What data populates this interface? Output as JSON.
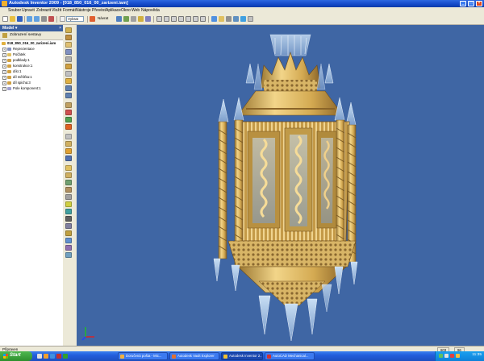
{
  "window": {
    "title": "Autodesk Inventor 2009 - [018_850_016_00_zarizeni.iam]",
    "buttons": {
      "minimize": "_",
      "maximize": "□",
      "close": "×"
    }
  },
  "menu": {
    "items": [
      "Soubor",
      "Upravit",
      "Zobrazit",
      "Vložit",
      "Formát",
      "Nástroje",
      "Převést",
      "Aplikace",
      "Okno",
      "Web",
      "Nápověda"
    ]
  },
  "toolbar": {
    "select_label": "Vybrat",
    "return_label": "Návrat"
  },
  "browser": {
    "title": "Model ▾",
    "close": "×",
    "filter_label": "Zobrazení sestavy",
    "root": "018_850_016_00_zarizeni.iam",
    "items": [
      "Reprezentace",
      "Počátek",
      "podklady:1",
      "konstrukce:1",
      "dílo:1",
      "díl měšťka:1",
      "díl spicha:3",
      "Pole komponent:1"
    ]
  },
  "viewport": {
    "background": "#3f66a4",
    "model_color": "#d9b45a",
    "glass_color": "#a9c6e8",
    "axis_colors": {
      "x": "#e02020",
      "y": "#20c020",
      "z": "#2040ff"
    }
  },
  "status": {
    "text": "Připraven",
    "coord_x": "603",
    "coord_y": "96"
  },
  "taskbar": {
    "start_label": "Start",
    "tasks": [
      "Doručená pošta - Mic...",
      "Autodesk Vault Explorer",
      "Autodesk Inventor 2...",
      "AutoCAD Mechanical..."
    ],
    "clock": "11:35"
  },
  "icons": {
    "app": "autodesk-inventor-icon",
    "start": "windows-logo-icon"
  }
}
